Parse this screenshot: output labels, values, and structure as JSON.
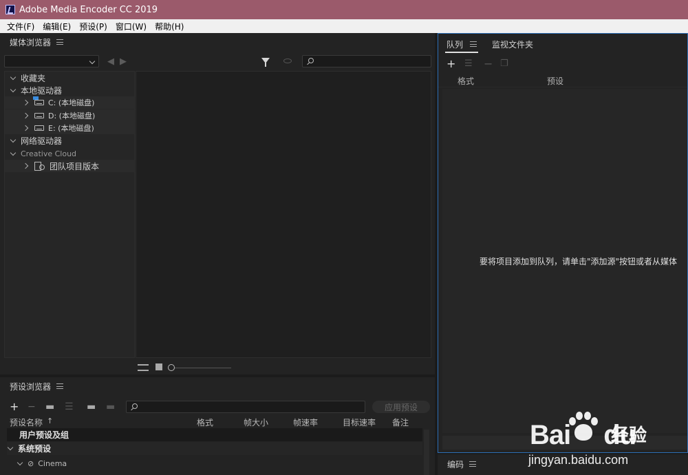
{
  "window": {
    "title": "Adobe Media Encoder CC 2019"
  },
  "menu": [
    "文件(F)",
    "编辑(E)",
    "预设(P)",
    "窗口(W)",
    "帮助(H)"
  ],
  "media_browser": {
    "title": "媒体浏览器",
    "tree": {
      "favorites": "收藏夹",
      "local_drives": "本地驱动器",
      "drives": [
        "C: (本地磁盘)",
        "D: (本地磁盘)",
        "E: (本地磁盘)"
      ],
      "network_drives": "网络驱动器",
      "creative_cloud": "Creative Cloud",
      "team_projects": "团队项目版本"
    }
  },
  "queue": {
    "tabs": [
      "队列",
      "监视文件夹"
    ],
    "columns": [
      "格式",
      "预设"
    ],
    "empty_message": "要将项目添加到队列，请单击\"添加源\"按钮或者从媒体"
  },
  "preset_browser": {
    "title": "预设浏览器",
    "apply_button": "应用预设",
    "columns": [
      "预设名称",
      "格式",
      "帧大小",
      "帧速率",
      "目标速率",
      "备注"
    ],
    "rows": {
      "user_presets": "用户预设及组",
      "system_presets": "系统预设",
      "cinema": "Cinema"
    }
  },
  "encoding": {
    "title": "编码"
  },
  "watermark": {
    "brand": "Bai",
    "brand_suffix": "du",
    "cn": "经验",
    "url": "jingyan.baidu.com"
  }
}
